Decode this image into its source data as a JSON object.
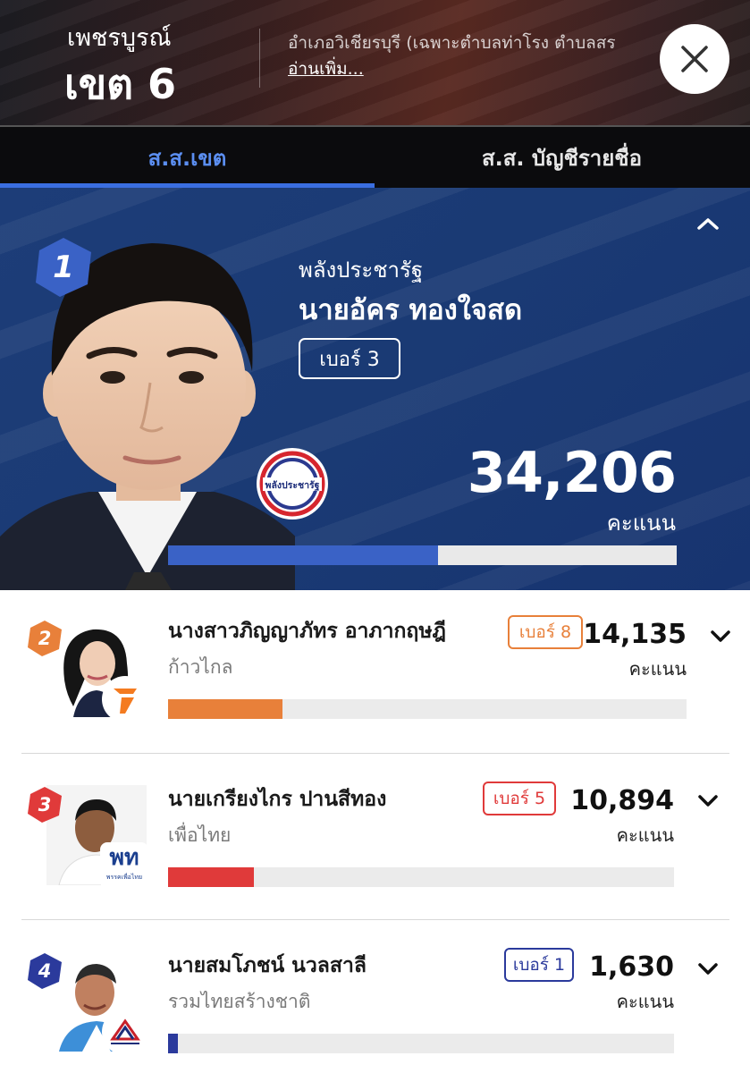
{
  "header": {
    "province": "เพชรบูรณ์",
    "district": "เขต 6",
    "area_desc": "อำเภอวิเชียรบุรี (เฉพาะตำบลท่าโรง ตำบลสร",
    "read_more": "อ่านเพิ่ม..."
  },
  "tabs": [
    {
      "label": "ส.ส.เขต",
      "active": true
    },
    {
      "label": "ส.ส. บัญชีรายชื่อ",
      "active": false
    }
  ],
  "winner": {
    "rank": "1",
    "party": "พลังประชารัฐ",
    "name": "นายอัคร ทองใจสด",
    "number": "เบอร์ 3",
    "votes": "34,206",
    "votes_label": "คะแนน",
    "vote_share": 0.53,
    "logo_text": "พลังประชารัฐ",
    "rank_color": "#3a62c6",
    "bar_color": "#3a62c6"
  },
  "candidates": [
    {
      "rank": "2",
      "name": "นางสาวภิญญาภัทร อาภากฤษฎี",
      "party": "ก้าวไกล",
      "number": "เบอร์ 8",
      "votes": "14,135",
      "votes_label": "คะแนน",
      "vote_share": 0.22,
      "color": "#e8803a",
      "logo_icon": "move-forward-logo-icon"
    },
    {
      "rank": "3",
      "name": "นายเกรียงไกร ปานสีทอง",
      "party": "เพื่อไทย",
      "number": "เบอร์ 5",
      "votes": "10,894",
      "votes_label": "คะแนน",
      "vote_share": 0.17,
      "color": "#e03a3a",
      "logo_text": "พท",
      "logo_sub": "พรรคเพื่อไทย"
    },
    {
      "rank": "4",
      "name": "นายสมโภชน์ นวลสาลี",
      "party": "รวมไทยสร้างชาติ",
      "number": "เบอร์ 1",
      "votes": "1,630",
      "votes_label": "คะแนน",
      "vote_share": 0.02,
      "color": "#2b3a9c",
      "logo_icon": "ruam-thai-logo-icon"
    }
  ],
  "icons": {
    "close": "close-icon",
    "collapse": "chevron-up-icon",
    "expand": "chevron-down-icon"
  }
}
